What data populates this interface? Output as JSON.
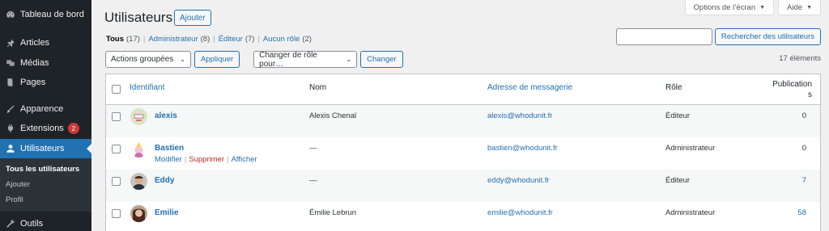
{
  "sidebar": {
    "items": [
      {
        "label": "Tableau de bord",
        "icon": "dashboard-icon"
      },
      {
        "label": "Articles",
        "icon": "pin-icon"
      },
      {
        "label": "Médias",
        "icon": "media-icon"
      },
      {
        "label": "Pages",
        "icon": "pages-icon"
      },
      {
        "label": "Apparence",
        "icon": "brush-icon"
      },
      {
        "label": "Extensions",
        "icon": "plugin-icon",
        "badge": "2"
      },
      {
        "label": "Utilisateurs",
        "icon": "users-icon"
      },
      {
        "label": "Outils",
        "icon": "wrench-icon"
      }
    ],
    "submenu": [
      "Tous les utilisateurs",
      "Ajouter",
      "Profil"
    ]
  },
  "screen_options": "Options de l’écran",
  "help": "Aide",
  "page": {
    "title": "Utilisateurs",
    "add_new": "Ajouter"
  },
  "filters": {
    "all": {
      "label": "Tous",
      "count": "(17)"
    },
    "admin": {
      "label": "Administrateur",
      "count": "(8)"
    },
    "editor": {
      "label": "Éditeur",
      "count": "(7)"
    },
    "none": {
      "label": "Aucun rôle",
      "count": "(2)"
    },
    "sep": "|"
  },
  "search": {
    "value": "",
    "button": "Rechercher des utilisateurs"
  },
  "bulk": {
    "select": "Actions groupées",
    "apply": "Appliquer"
  },
  "role_change": {
    "select": "Changer de rôle pour…",
    "button": "Changer"
  },
  "items_count": "17 éléments",
  "table": {
    "headers": {
      "username": "Identifiant",
      "name": "Nom",
      "email": "Adresse de messagerie",
      "role": "Rôle",
      "posts_line1": "Publication",
      "posts_line2": "s"
    },
    "rows": [
      {
        "username": "alexis",
        "name": "Alexis Chenal",
        "email": "alexis@whodunit.fr",
        "role": "Éditeur",
        "posts": "0"
      },
      {
        "username": "Bastien",
        "name": "—",
        "email": "bastien@whodunit.fr",
        "role": "Administrateur",
        "posts": "0"
      },
      {
        "username": "Eddy",
        "name": "—",
        "email": "eddy@whodunit.fr",
        "role": "Éditeur",
        "posts": "7"
      },
      {
        "username": "Emilie",
        "name": "Émilie Lebrun",
        "email": "emilie@whodunit.fr",
        "role": "Administrateur",
        "posts": "58"
      }
    ],
    "row_actions": {
      "edit": "Modifier",
      "delete": "Supprimer",
      "view": "Afficher",
      "sep": "|"
    }
  },
  "colors": {
    "sidebar": "#1d2327",
    "accent": "#2271b1",
    "danger": "#b32d2e",
    "badge": "#d63638"
  }
}
